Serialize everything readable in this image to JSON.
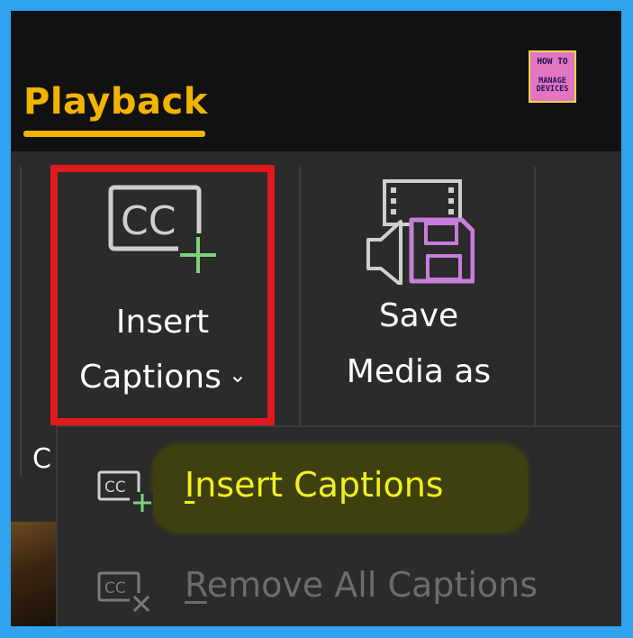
{
  "ribbon": {
    "active_tab": "Playback",
    "group_label_partial": "C",
    "buttons": {
      "insert_captions": {
        "line1": "Insert",
        "line2": "Captions",
        "dropdown_indicator": "chevron-down-icon"
      },
      "save_media_as": {
        "line1": "Save",
        "line2": "Media as"
      }
    }
  },
  "logo": {
    "line1": "HOW TO",
    "line2": "MANAGE DEVICES"
  },
  "dropdown_menu": {
    "items": [
      {
        "access_key": "I",
        "label_rest": "nsert Captions",
        "icon": "insert-captions-icon",
        "enabled": true,
        "highlighted": true
      },
      {
        "access_key": "R",
        "label_rest": "emove All Captions",
        "icon": "remove-captions-icon",
        "enabled": false
      }
    ]
  },
  "colors": {
    "outer_border": "#2fa3f0",
    "accent_tab": "#f2b400",
    "red_highlight_box": "#e3191f",
    "menu_highlight_text": "#f0f020",
    "disabled_text": "#6c6c6c",
    "ribbon_bg": "#2b2b2b",
    "icon_green_plus": "#7ed27e",
    "icon_purple_disk": "#c77ddb"
  }
}
